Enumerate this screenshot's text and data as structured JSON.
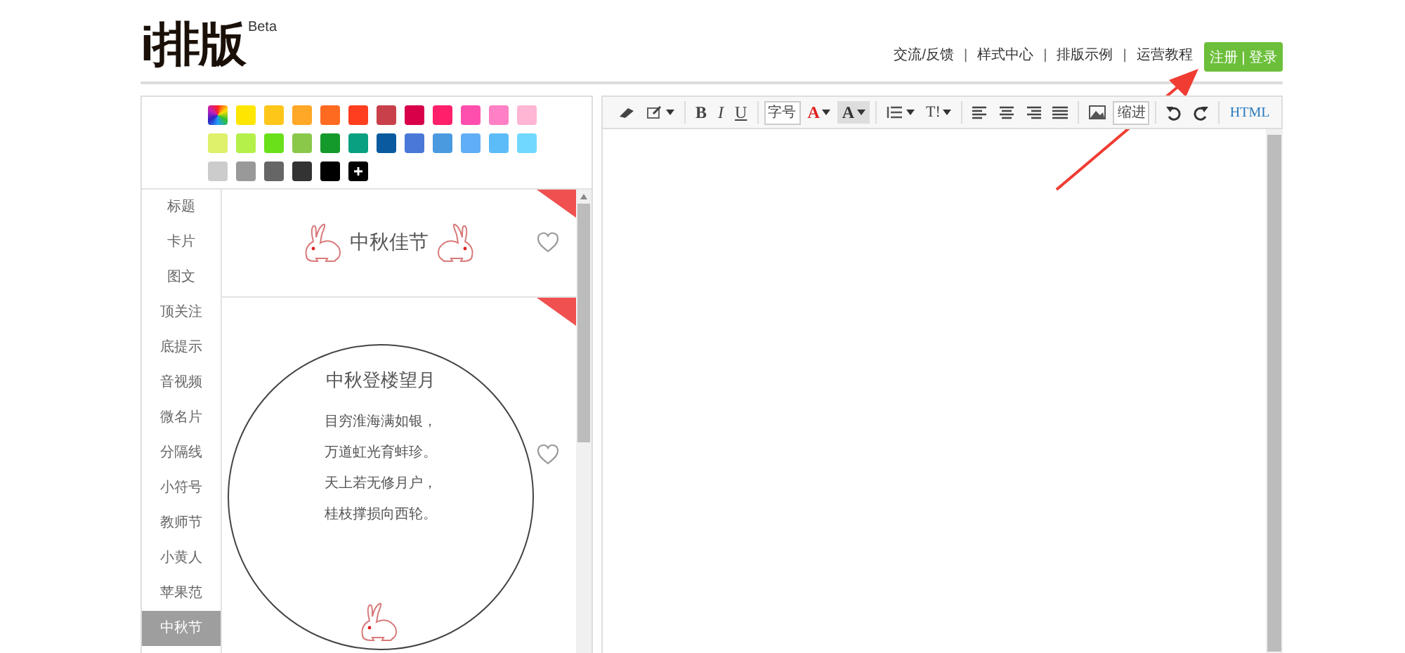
{
  "header": {
    "logo": "i排版",
    "logo_badge": "Beta",
    "nav": [
      {
        "kind": "link",
        "text": "交流/反馈"
      },
      {
        "kind": "separator",
        "text": "|"
      },
      {
        "kind": "link",
        "text": "样式中心"
      },
      {
        "kind": "separator",
        "text": "|"
      },
      {
        "kind": "link",
        "text": "排版示例"
      },
      {
        "kind": "separator",
        "text": "|"
      },
      {
        "kind": "link",
        "text": "运营教程"
      }
    ],
    "auth_button": "注册 | 登录"
  },
  "palette": {
    "rows": [
      [
        {
          "kind": "rainbow"
        },
        {
          "kind": "plain",
          "color": "#ffe600"
        },
        {
          "kind": "plain",
          "color": "#ffc61a"
        },
        {
          "kind": "plain",
          "color": "#ffa726"
        },
        {
          "kind": "plain",
          "color": "#ff6a21"
        },
        {
          "kind": "plain",
          "color": "#ff3d1f"
        },
        {
          "kind": "plain",
          "color": "#c8404a"
        },
        {
          "kind": "plain",
          "color": "#d9004a"
        },
        {
          "kind": "plain",
          "color": "#ff1f6a"
        },
        {
          "kind": "plain",
          "color": "#ff4fae"
        },
        {
          "kind": "plain",
          "color": "#ff80c4"
        },
        {
          "kind": "plain",
          "color": "#ffb5d4"
        }
      ],
      [
        {
          "kind": "plain",
          "color": "#dff06a"
        },
        {
          "kind": "plain",
          "color": "#b5f04a"
        },
        {
          "kind": "plain",
          "color": "#6ae01a"
        },
        {
          "kind": "plain",
          "color": "#8ac84a"
        },
        {
          "kind": "plain",
          "color": "#149a2a"
        },
        {
          "kind": "plain",
          "color": "#08a080"
        },
        {
          "kind": "plain",
          "color": "#0a5aa0"
        },
        {
          "kind": "plain",
          "color": "#4a78d8"
        },
        {
          "kind": "plain",
          "color": "#4a9ae0"
        },
        {
          "kind": "plain",
          "color": "#60aef5"
        },
        {
          "kind": "plain",
          "color": "#5cbcf8"
        },
        {
          "kind": "plain",
          "color": "#70d8ff"
        }
      ],
      [
        {
          "kind": "plain",
          "color": "#cccccc"
        },
        {
          "kind": "plain",
          "color": "#999999"
        },
        {
          "kind": "plain",
          "color": "#666666"
        },
        {
          "kind": "plain",
          "color": "#333333"
        },
        {
          "kind": "plain",
          "color": "#000000"
        },
        {
          "kind": "custom"
        }
      ]
    ]
  },
  "categories": [
    {
      "label": "标题",
      "selected": false
    },
    {
      "label": "卡片",
      "selected": false
    },
    {
      "label": "图文",
      "selected": false
    },
    {
      "label": "顶关注",
      "selected": false
    },
    {
      "label": "底提示",
      "selected": false
    },
    {
      "label": "音视频",
      "selected": false
    },
    {
      "label": "微名片",
      "selected": false
    },
    {
      "label": "分隔线",
      "selected": false
    },
    {
      "label": "小符号",
      "selected": false
    },
    {
      "label": "教师节",
      "selected": false
    },
    {
      "label": "小黄人",
      "selected": false
    },
    {
      "label": "苹果范",
      "selected": false
    },
    {
      "label": "中秋节",
      "selected": true
    }
  ],
  "templates": [
    {
      "kind": "banner",
      "title": "中秋佳节"
    },
    {
      "kind": "poem",
      "title": "中秋登楼望月",
      "lines": [
        "目穷淮海满如银，",
        "万道虹光育蚌珍。",
        "天上若无修月户，",
        "桂枝撑损向西轮。"
      ]
    }
  ],
  "toolbar": [
    [
      {
        "kind": "eraser",
        "dropdown": false
      },
      {
        "kind": "edit",
        "dropdown": true
      }
    ],
    [
      {
        "kind": "bold",
        "label": "B",
        "dropdown": false
      },
      {
        "kind": "italic",
        "label": "I",
        "dropdown": false
      },
      {
        "kind": "underline",
        "label": "U",
        "dropdown": false
      }
    ],
    [
      {
        "kind": "boxed",
        "label": "字号",
        "dropdown": false
      },
      {
        "kind": "fontcolor",
        "label": "A",
        "dropdown": true
      },
      {
        "kind": "backcolor",
        "label": "A",
        "dropdown": true
      }
    ],
    [
      {
        "kind": "list",
        "dropdown": true
      },
      {
        "kind": "text",
        "label": "T!",
        "dropdown": true
      }
    ],
    [
      {
        "kind": "align-left",
        "dropdown": false
      },
      {
        "kind": "align-center",
        "dropdown": false
      },
      {
        "kind": "align-right",
        "dropdown": false
      },
      {
        "kind": "justify",
        "dropdown": false
      }
    ],
    [
      {
        "kind": "image",
        "dropdown": false
      },
      {
        "kind": "boxed",
        "label": "缩进",
        "dropdown": false
      }
    ],
    [
      {
        "kind": "undo",
        "dropdown": false
      },
      {
        "kind": "redo",
        "dropdown": false
      }
    ],
    [
      {
        "kind": "html",
        "label": "HTML",
        "dropdown": false
      }
    ]
  ]
}
